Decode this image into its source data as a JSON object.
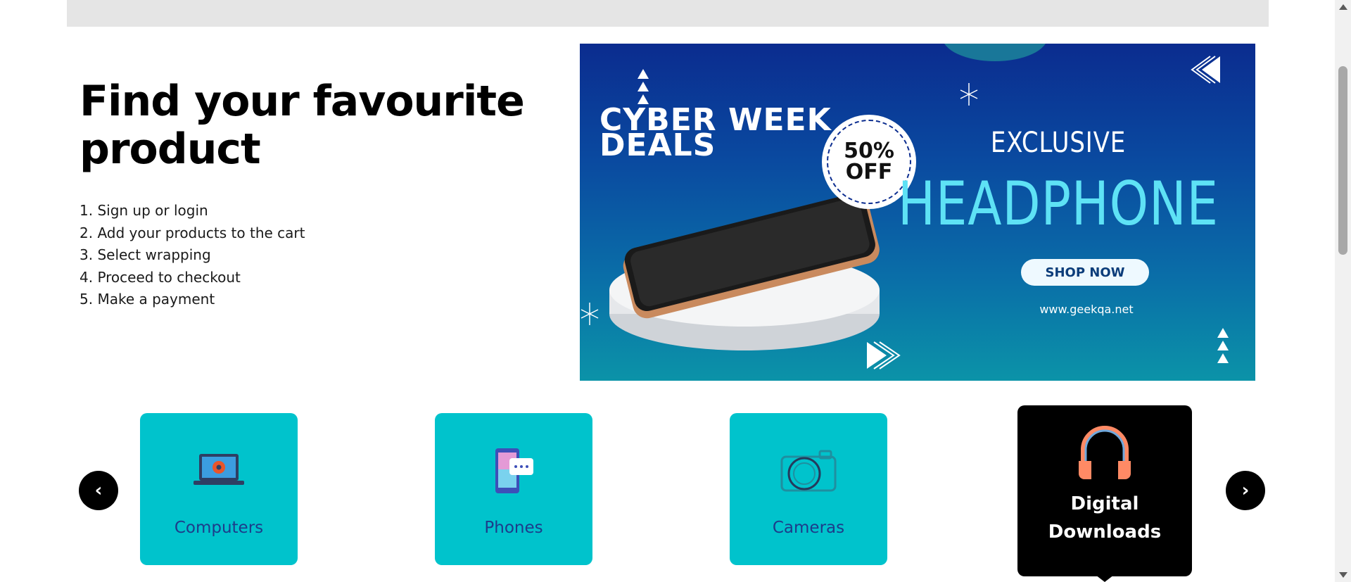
{
  "hero": {
    "title_line1": "Find your favourite",
    "title_line2": "product",
    "steps": [
      "1. Sign up or login",
      "2. Add your products to the cart",
      "3. Select wrapping",
      "4. Proceed to checkout",
      "5. Make a payment"
    ]
  },
  "banner": {
    "deal_line1": "CYBER WEEK",
    "deal_line2": "DEALS",
    "badge_line1": "50%",
    "badge_line2": "OFF",
    "exclusive": "EXCLUSIVE",
    "headline": "HEADPHONE",
    "cta": "SHOP NOW",
    "site": "www.geekqa.net"
  },
  "carousel": {
    "prev_label": "‹",
    "next_label": "›",
    "categories": [
      {
        "label": "Computers",
        "icon": "laptop-icon"
      },
      {
        "label": "Phones",
        "icon": "phone-chat-icon"
      },
      {
        "label": "Cameras",
        "icon": "camera-icon"
      },
      {
        "label": "Digital Downloads",
        "icon": "headphones-icon",
        "label_line1": "Digital",
        "label_line2": "Downloads",
        "active": true
      }
    ]
  },
  "colors": {
    "tile": "#00c3cc",
    "tile_active": "#000000",
    "tile_label": "#1d3c8a",
    "headline_accent": "#5ee2f5"
  }
}
